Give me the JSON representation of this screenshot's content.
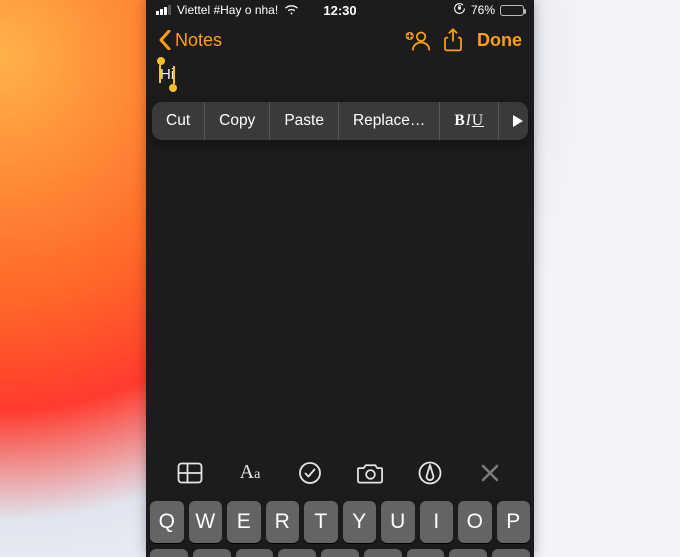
{
  "status": {
    "carrier": "Viettel #Hay o nha!",
    "time": "12:30",
    "battery_pct": "76%",
    "battery_fill_pct": 76
  },
  "nav": {
    "back_label": "Notes",
    "done_label": "Done"
  },
  "note": {
    "selected_text": "Hi"
  },
  "context_menu": {
    "cut": "Cut",
    "copy": "Copy",
    "paste": "Paste",
    "replace": "Replace…"
  },
  "keyboard": {
    "row1": [
      "Q",
      "W",
      "E",
      "R",
      "T",
      "Y",
      "U",
      "I",
      "O",
      "P"
    ]
  },
  "colors": {
    "accent": "#ff9f0a",
    "menu_bg": "#3a3a3c",
    "key_bg": "#646466"
  }
}
